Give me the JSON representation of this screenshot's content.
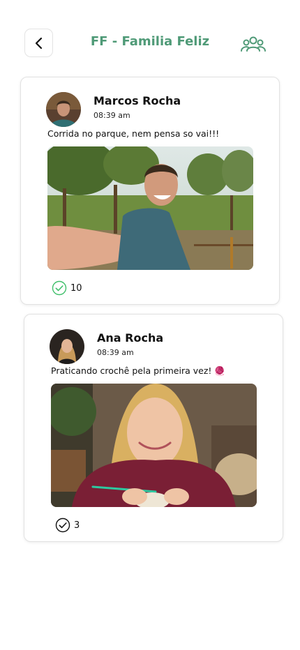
{
  "header": {
    "title": "FF - Familia Feliz",
    "back_icon": "chevron-left-icon",
    "members_icon": "group-icon"
  },
  "colors": {
    "accent": "#4f9a77",
    "check_green": "#3fbf6a"
  },
  "posts": [
    {
      "author": "Marcos Rocha",
      "time": "08:39 am",
      "caption": "Corrida no parque, nem pensa so vai!!!",
      "likes": "10",
      "liked": true
    },
    {
      "author": "Ana Rocha",
      "time": "08:39 am",
      "caption": "Praticando crochê pela primeira vez! 🧶",
      "likes": "3",
      "liked": false
    }
  ]
}
